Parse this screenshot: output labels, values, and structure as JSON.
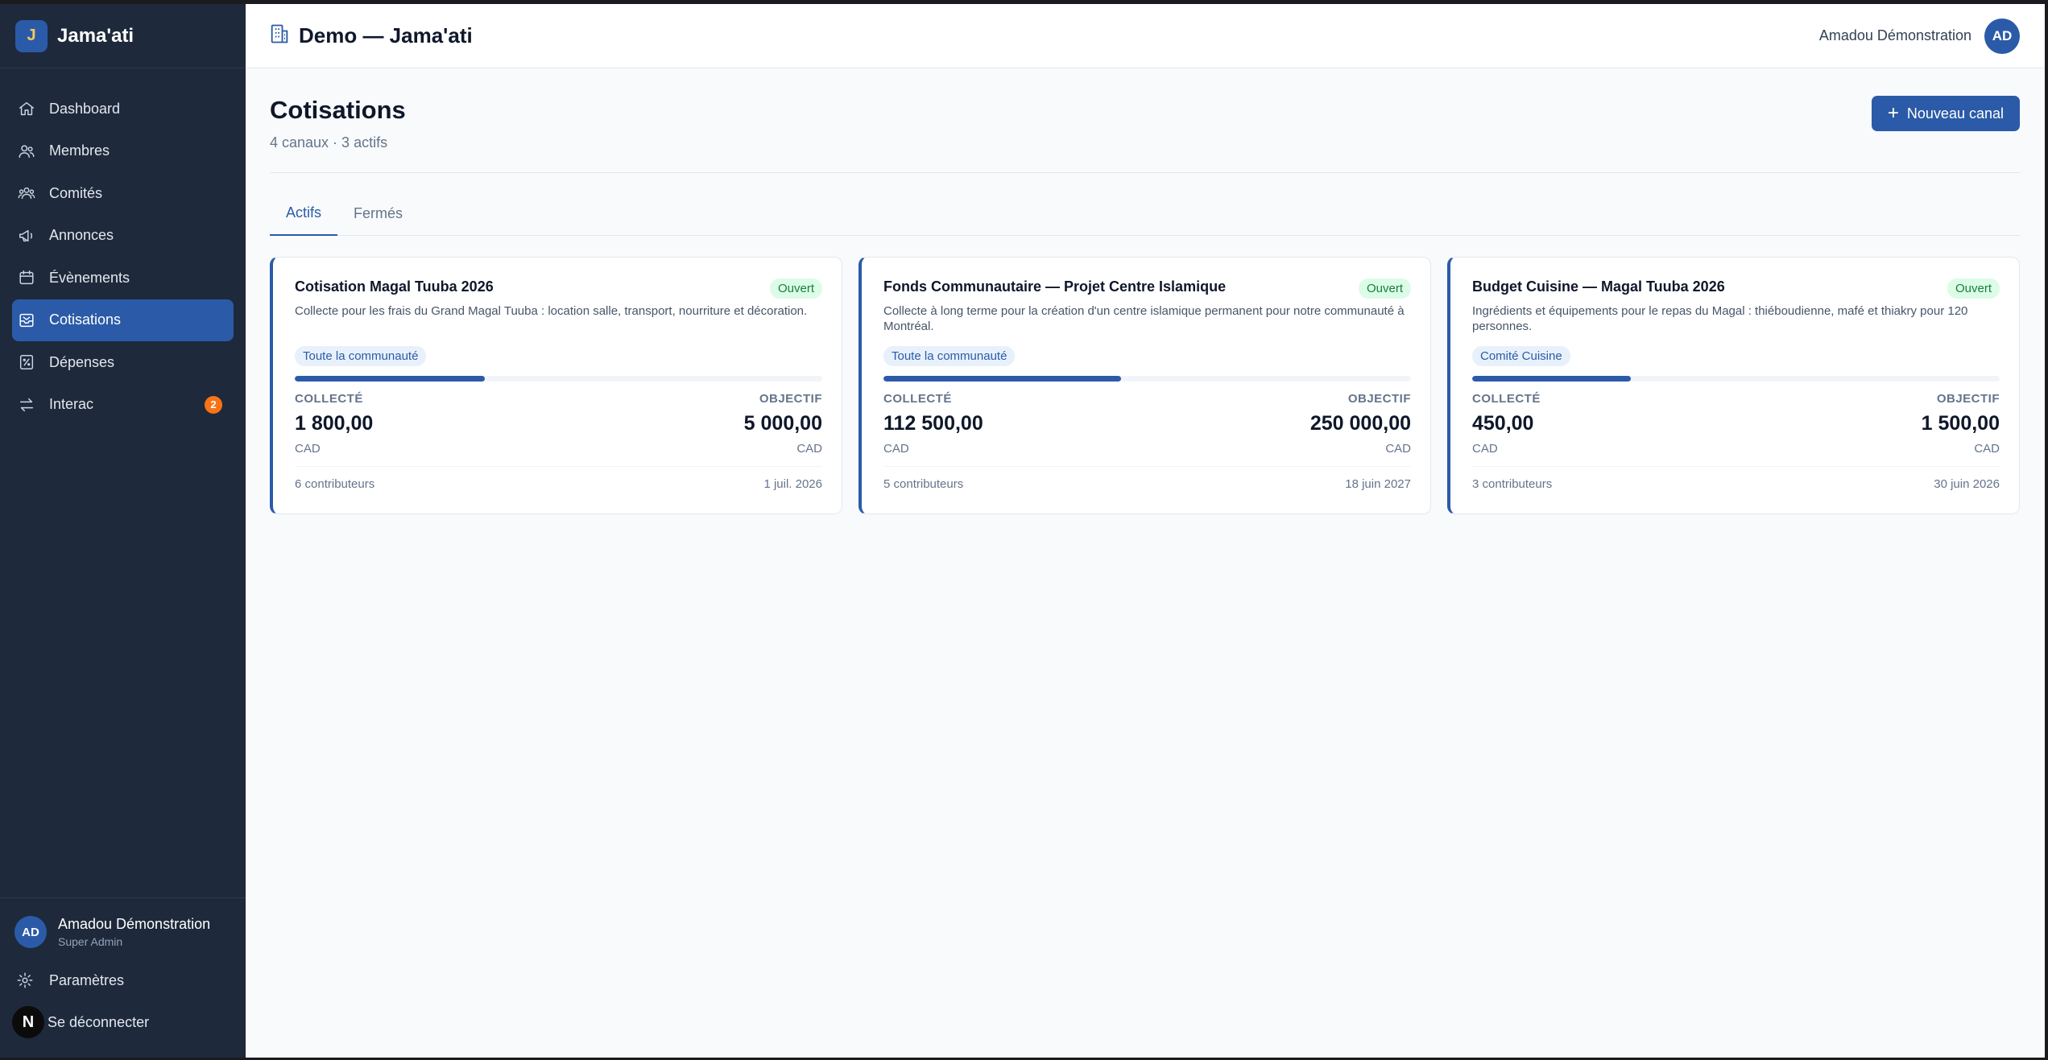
{
  "brand": {
    "logo_letter": "J",
    "name": "Jama'ati"
  },
  "nav": {
    "items": [
      {
        "label": "Dashboard",
        "icon": "home-icon"
      },
      {
        "label": "Membres",
        "icon": "users-icon"
      },
      {
        "label": "Comités",
        "icon": "committee-icon"
      },
      {
        "label": "Annonces",
        "icon": "megaphone-icon"
      },
      {
        "label": "Évènements",
        "icon": "calendar-icon"
      },
      {
        "label": "Cotisations",
        "icon": "inbox-icon",
        "active": true
      },
      {
        "label": "Dépenses",
        "icon": "receipt-icon"
      },
      {
        "label": "Interac",
        "icon": "transfer-icon",
        "badge": "2"
      }
    ]
  },
  "sidebar_user": {
    "initials": "AD",
    "name": "Amadou Démonstration",
    "role": "Super Admin"
  },
  "sidebar_links": {
    "settings": "Paramètres",
    "logout": "Se déconnecter",
    "logout_letter": "N"
  },
  "topbar": {
    "org_title": "Demo — Jama'ati",
    "user_name": "Amadou Démonstration",
    "user_initials": "AD"
  },
  "page": {
    "title": "Cotisations",
    "subtitle": "4 canaux · 3 actifs",
    "new_button": "Nouveau canal"
  },
  "tabs": [
    {
      "label": "Actifs",
      "active": true
    },
    {
      "label": "Fermés",
      "active": false
    }
  ],
  "cards": [
    {
      "title": "Cotisation Magal Tuuba 2026",
      "status": "Ouvert",
      "description": "Collecte pour les frais du Grand Magal Tuuba : location salle, transport, nourriture et décoration.",
      "tag": "Toute la communauté",
      "progress": 0.36,
      "collected_label": "COLLECTÉ",
      "collected": "1 800,00",
      "goal_label": "OBJECTIF",
      "goal": "5 000,00",
      "currency": "CAD",
      "contributors": "6 contributeurs",
      "date": "1 juil. 2026"
    },
    {
      "title": "Fonds Communautaire — Projet Centre Islamique",
      "status": "Ouvert",
      "description": "Collecte à long terme pour la création d'un centre islamique permanent pour notre communauté à Montréal.",
      "tag": "Toute la communauté",
      "progress": 0.45,
      "collected_label": "COLLECTÉ",
      "collected": "112 500,00",
      "goal_label": "OBJECTIF",
      "goal": "250 000,00",
      "currency": "CAD",
      "contributors": "5 contributeurs",
      "date": "18 juin 2027"
    },
    {
      "title": "Budget Cuisine — Magal Tuuba 2026",
      "status": "Ouvert",
      "description": "Ingrédients et équipements pour le repas du Magal : thiéboudienne, mafé et thiakry pour 120 personnes.",
      "tag": "Comité Cuisine",
      "progress": 0.3,
      "collected_label": "COLLECTÉ",
      "collected": "450,00",
      "goal_label": "OBJECTIF",
      "goal": "1 500,00",
      "currency": "CAD",
      "contributors": "3 contributeurs",
      "date": "30 juin 2026"
    }
  ],
  "colors": {
    "sidebar": "#1e293b",
    "accent": "#2b5ba8",
    "status_open": "#15803d",
    "badge": "#f97316"
  }
}
